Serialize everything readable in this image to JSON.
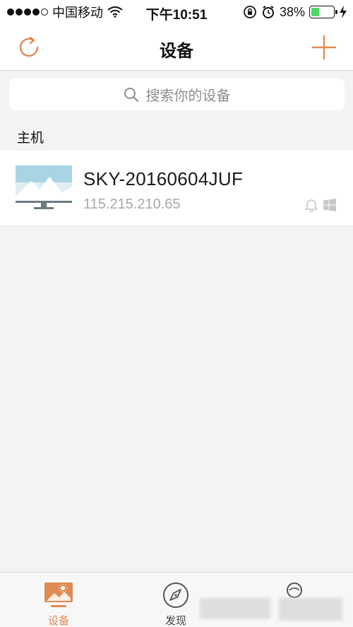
{
  "status_bar": {
    "carrier": "中国移动",
    "time": "下午10:51",
    "battery_percent": "38%",
    "battery_level": 0.38,
    "signal_bars": 4
  },
  "nav": {
    "title": "设备",
    "refresh_icon": "refresh-icon",
    "add_icon": "plus-icon"
  },
  "search": {
    "placeholder": "搜索你的设备"
  },
  "section": {
    "title": "主机"
  },
  "devices": [
    {
      "name": "SKY-20160604JUF",
      "ip": "115.215.210.65",
      "icon": "monitor-icon",
      "status_icons": [
        "bell-icon",
        "windows-icon"
      ]
    }
  ],
  "tabs": [
    {
      "label": "设备",
      "icon": "device-tab-icon",
      "active": true
    },
    {
      "label": "发现",
      "icon": "compass-icon",
      "active": false
    },
    {
      "label": "",
      "icon": "profile-tab-icon",
      "active": false
    }
  ],
  "colors": {
    "accent": "#e08a55",
    "background": "#f3f3f3",
    "battery": "#4cd964"
  }
}
